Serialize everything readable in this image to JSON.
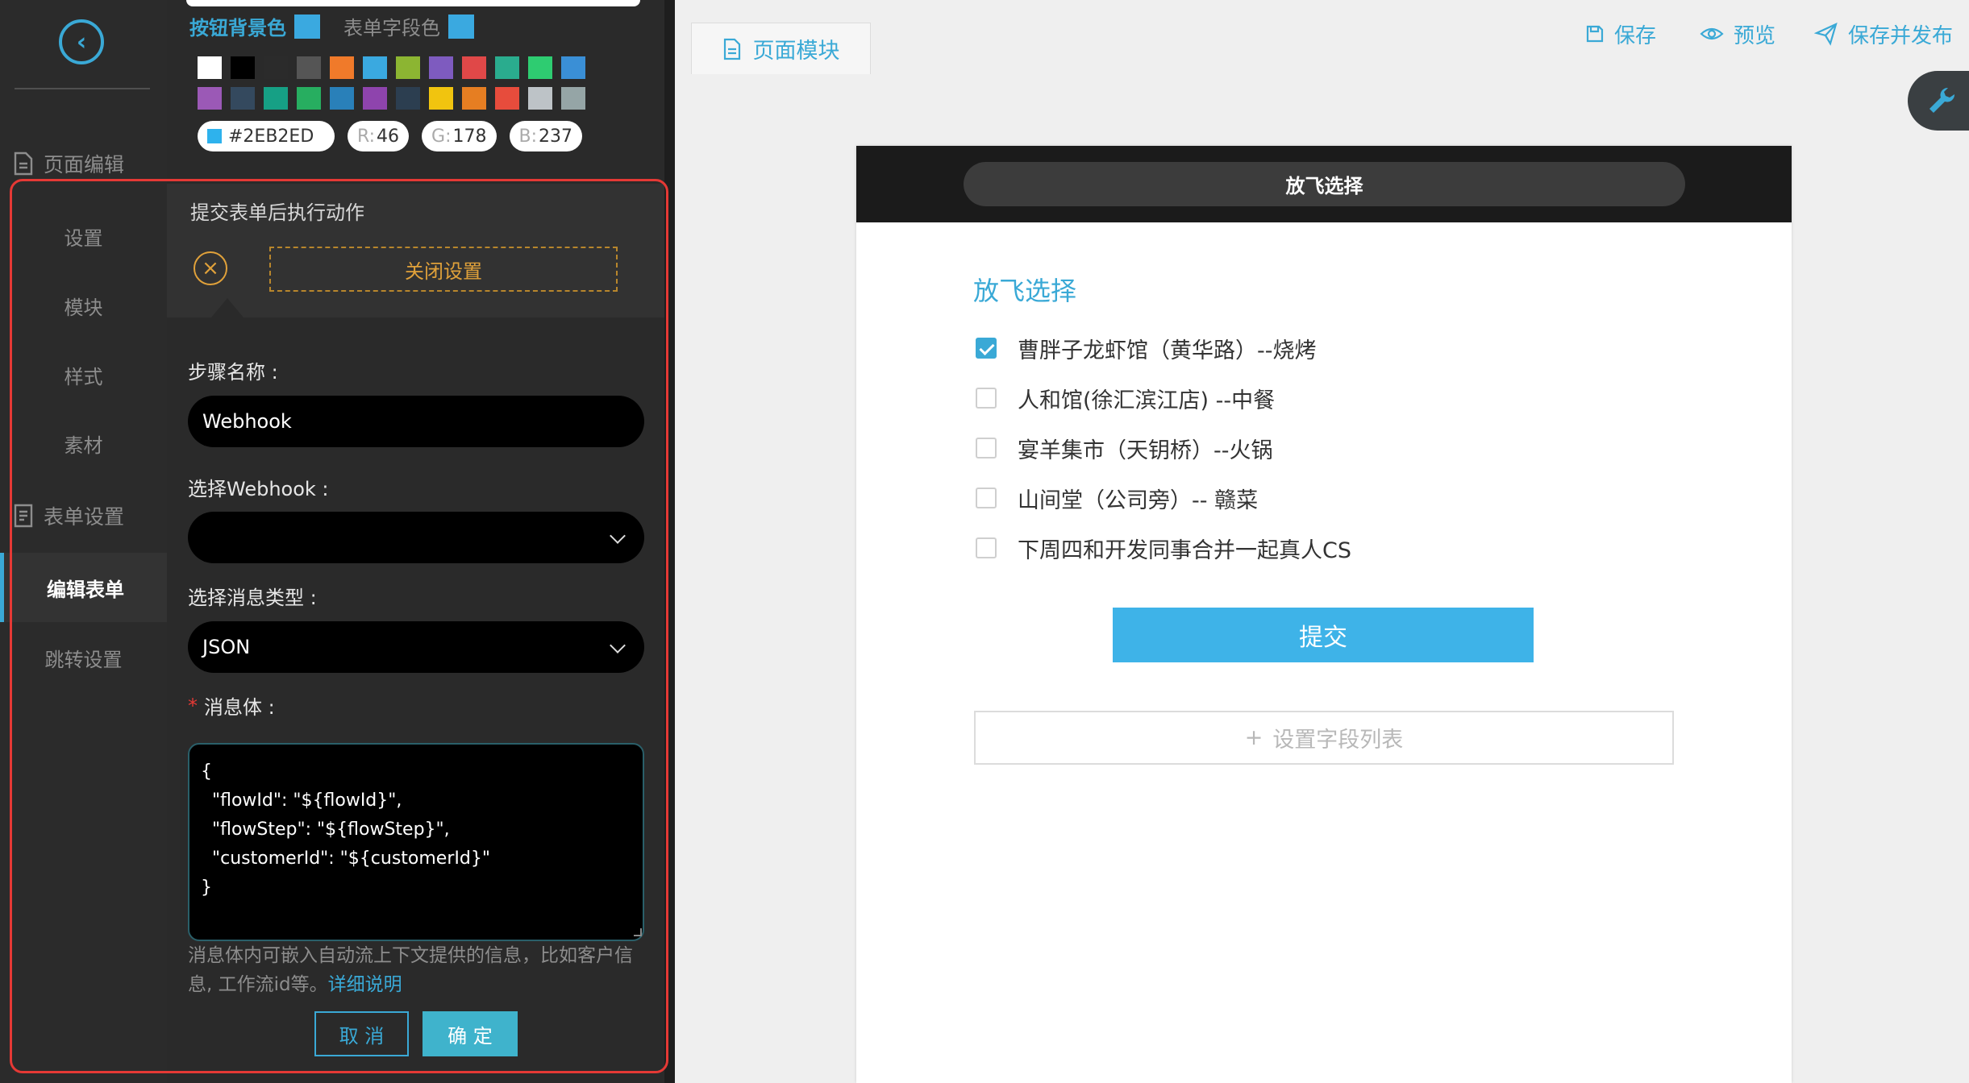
{
  "nav": {
    "sections": [
      {
        "label": "页面编辑"
      },
      {
        "label": "表单设置"
      }
    ],
    "page_items": [
      "设置",
      "模块",
      "样式",
      "素材"
    ],
    "form_items": [
      "编辑表单",
      "跳转设置"
    ]
  },
  "color_picker": {
    "button_bg_label": "按钮背景色",
    "field_color_label": "表单字段色",
    "hex": "#2EB2ED",
    "r_label": "R:",
    "r": "46",
    "g_label": "G:",
    "g": "178",
    "b_label": "B:",
    "b": "237",
    "swatches_row1": [
      "#ffffff",
      "#000000",
      "#2b2b2b",
      "#555555",
      "#f07a2a",
      "#3aa9e0",
      "#8cb532",
      "#7e5bbf",
      "#e04848",
      "#2aac8e",
      "#2ecc71",
      "#3a8fd6"
    ],
    "swatches_row2": [
      "#9b59b6",
      "#34495e",
      "#16a085",
      "#27ae60",
      "#2980b9",
      "#8e44ad",
      "#2c3e50",
      "#f1c40f",
      "#e67e22",
      "#e74c3c",
      "#bdc3c7",
      "#95a5a6"
    ]
  },
  "panel": {
    "section_title": "提交表单后执行动作",
    "close_settings": "关闭设置",
    "step_name_label": "步骤名称 :",
    "step_name_value": "Webhook",
    "webhook_label": "选择Webhook :",
    "webhook_value": "",
    "msg_type_label": "选择消息类型 :",
    "msg_type_value": "JSON",
    "required_mark": "*",
    "body_label": "消息体 :",
    "body_value": "{\n  \"flowId\": \"${flowId}\",\n  \"flowStep\": \"${flowStep}\",\n  \"customerId\": \"${customerId}\"\n}",
    "hint_text": "消息体内可嵌入自动流上下文提供的信息，比如客户信息, 工作流id等。",
    "hint_link": "详细说明",
    "cancel": "取 消",
    "confirm": "确 定"
  },
  "topbar": {
    "tab_label": "页面模块",
    "save": "保存",
    "preview": "预览",
    "save_publish": "保存并发布"
  },
  "preview": {
    "header_title": "放飞选择",
    "question_title": "放飞选择",
    "options": [
      {
        "label": "曹胖子龙虾馆（黄华路）--烧烤",
        "checked": true
      },
      {
        "label": "人和馆(徐汇滨江店) --中餐",
        "checked": false
      },
      {
        "label": "宴羊集市（天钥桥）--火锅",
        "checked": false
      },
      {
        "label": "山间堂（公司旁）-- 赣菜",
        "checked": false
      },
      {
        "label": "下周四和开发同事合并一起真人CS",
        "checked": false
      }
    ],
    "submit": "提交",
    "add_field_list": "设置字段列表",
    "plus": "+"
  },
  "colors": {
    "accent": "#3aa9d6",
    "highlight_border": "#e53935",
    "warning_orange": "#e0a13a"
  }
}
